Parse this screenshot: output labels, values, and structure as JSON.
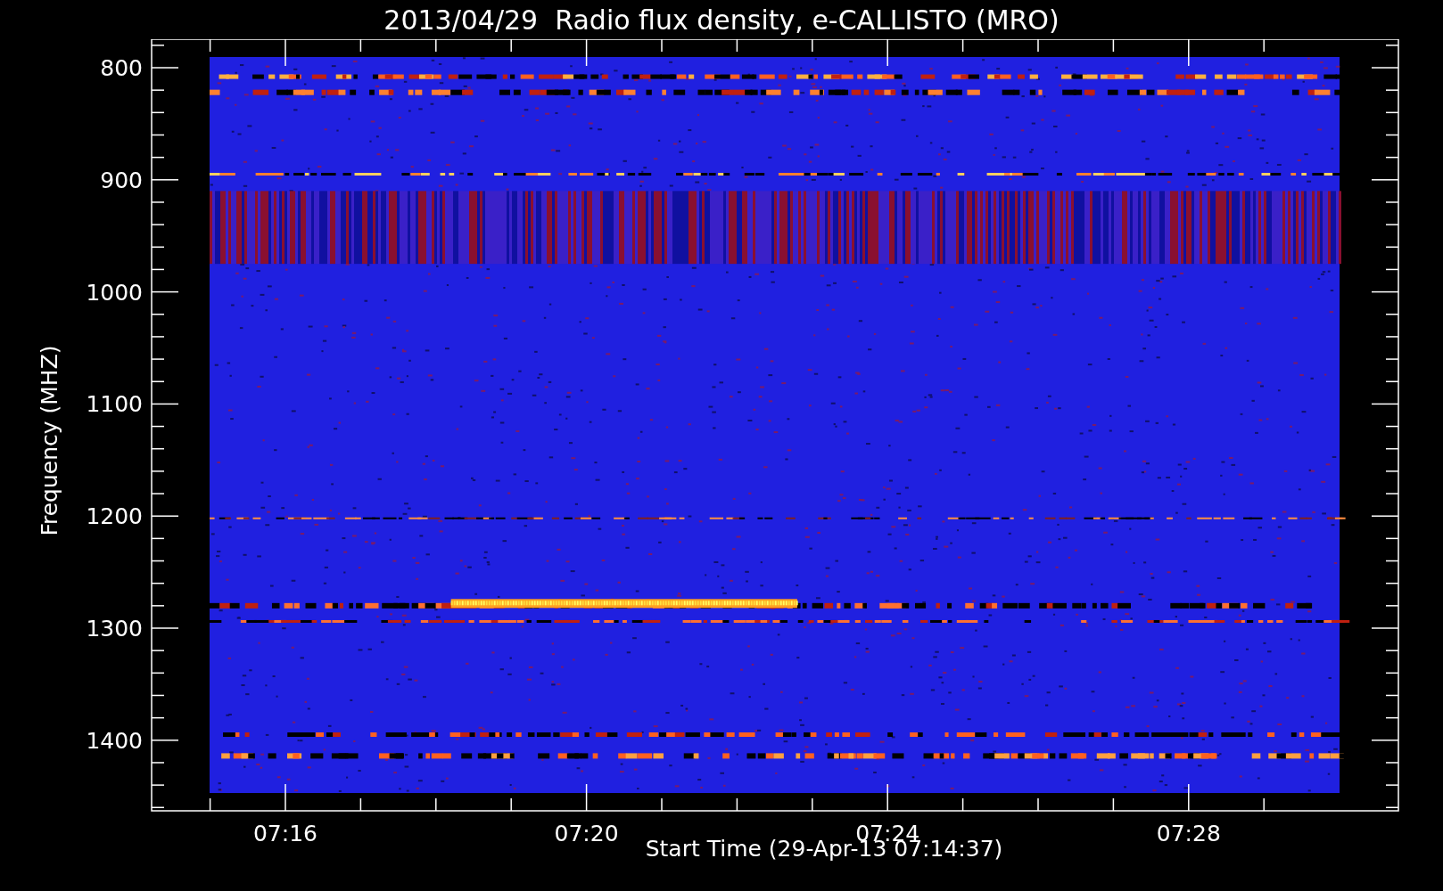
{
  "title": "2013/04/29  Radio flux density, e-CALLISTO (MRO)",
  "plot": {
    "ylabel": "Frequency (MHZ)",
    "xlabel": "Start Time (29-Apr-13 07:14:37)",
    "yticks": [
      "800",
      "900",
      "1000",
      "1100",
      "1200",
      "1300",
      "1400"
    ],
    "xticks": [
      "07:16",
      "07:20",
      "07:24",
      "07:28"
    ]
  }
}
